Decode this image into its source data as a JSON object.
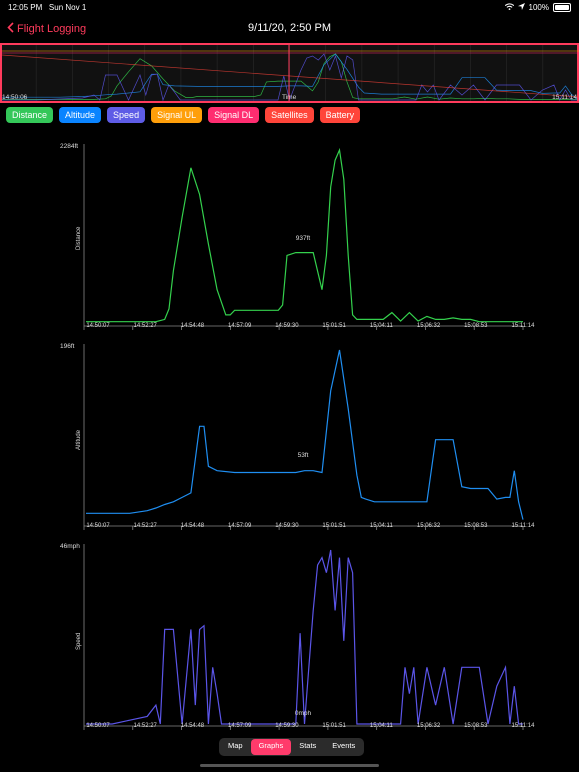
{
  "status": {
    "time": "12:05 PM",
    "date": "Sun Nov 1",
    "battery": "100%"
  },
  "nav": {
    "back_label": "Flight Logging",
    "title": "9/11/20, 2:50 PM"
  },
  "overview": {
    "start": "14:50:06",
    "axis_label": "Time",
    "end": "15:11:14"
  },
  "chips": [
    {
      "label": "Distance",
      "color": "#34c759"
    },
    {
      "label": "Altitude",
      "color": "#0a84ff"
    },
    {
      "label": "Speed",
      "color": "#5e5ce6"
    },
    {
      "label": "Signal UL",
      "color": "#ff9f0a"
    },
    {
      "label": "Signal DL",
      "color": "#ff2d70"
    },
    {
      "label": "Satellites",
      "color": "#ff453a"
    },
    {
      "label": "Battery",
      "color": "#ff453a"
    }
  ],
  "x_ticks": [
    "14:50:07",
    "14:52:27",
    "14:54:48",
    "14:57:09",
    "14:59:30",
    "15:01:51",
    "15:04:11",
    "15:06:32",
    "15:08:53",
    "15:11:14"
  ],
  "chart_data": [
    {
      "type": "line",
      "ylabel": "Distance",
      "ymax_label": "2284ft",
      "annotation": "937ft",
      "color": "#34d14d",
      "ylim": [
        0,
        2284
      ],
      "x": [
        0,
        4,
        8,
        12,
        16,
        18,
        19,
        20,
        22,
        24,
        26,
        28,
        30,
        32,
        33,
        34,
        36,
        38,
        40,
        41,
        42,
        43,
        44,
        45,
        46,
        48,
        50,
        52,
        54,
        55,
        56,
        57,
        58,
        59,
        60,
        61,
        62,
        64,
        66,
        68,
        70,
        72,
        74,
        76,
        78,
        80,
        82,
        84,
        86,
        88,
        90,
        92,
        94,
        96,
        100
      ],
      "y": [
        30,
        30,
        30,
        30,
        30,
        60,
        200,
        700,
        1400,
        2050,
        1700,
        1050,
        450,
        120,
        120,
        180,
        180,
        180,
        180,
        180,
        180,
        180,
        180,
        250,
        900,
        937,
        937,
        937,
        450,
        900,
        1800,
        2150,
        2284,
        1900,
        900,
        120,
        60,
        60,
        60,
        60,
        150,
        40,
        150,
        40,
        100,
        60,
        60,
        80,
        60,
        60,
        30,
        30,
        30,
        30,
        30
      ]
    },
    {
      "type": "line",
      "ylabel": "Altitude",
      "ymax_label": "196ft",
      "annotation": "53ft",
      "color": "#1f8ef1",
      "ylim": [
        0,
        196
      ],
      "x": [
        0,
        6,
        10,
        14,
        16,
        18,
        20,
        22,
        24,
        26,
        27,
        28,
        30,
        34,
        38,
        42,
        46,
        48,
        50,
        52,
        54,
        56,
        58,
        60,
        62,
        63,
        64,
        66,
        68,
        72,
        74,
        76,
        78,
        80,
        82,
        84,
        86,
        88,
        90,
        92,
        94,
        96,
        97,
        98,
        99,
        100
      ],
      "y": [
        12,
        12,
        12,
        15,
        18,
        22,
        25,
        30,
        35,
        110,
        110,
        65,
        60,
        58,
        58,
        58,
        58,
        58,
        60,
        60,
        58,
        150,
        196,
        130,
        55,
        30,
        28,
        25,
        25,
        25,
        25,
        25,
        25,
        95,
        95,
        95,
        42,
        40,
        40,
        40,
        28,
        30,
        30,
        60,
        25,
        5
      ]
    },
    {
      "type": "line",
      "ylabel": "Speed",
      "ymax_label": "46mph",
      "annotation": "0mph",
      "color": "#5b55e8",
      "ylim": [
        0,
        46
      ],
      "x": [
        0,
        6,
        10,
        14,
        16,
        17,
        18,
        19,
        20,
        22,
        24,
        25,
        26,
        27,
        28,
        29,
        30,
        31,
        32,
        33,
        34,
        36,
        38,
        40,
        42,
        44,
        46,
        47,
        48,
        49,
        50,
        52,
        53,
        54,
        55,
        56,
        57,
        58,
        59,
        60,
        61,
        62,
        63,
        64,
        66,
        68,
        70,
        72,
        73,
        74,
        75,
        76,
        78,
        80,
        82,
        84,
        86,
        88,
        90,
        92,
        94,
        96,
        97,
        98,
        99,
        100
      ],
      "y": [
        0,
        0,
        1,
        2,
        5,
        0,
        25,
        25,
        25,
        0,
        25,
        5,
        25,
        26,
        0,
        15,
        8,
        0,
        0,
        0,
        0,
        0,
        0,
        0,
        0,
        0,
        0,
        0,
        0,
        24,
        0,
        30,
        42,
        44,
        40,
        46,
        30,
        44,
        22,
        44,
        40,
        0,
        0,
        0,
        0,
        0,
        0,
        0,
        15,
        8,
        15,
        0,
        15,
        5,
        15,
        0,
        15,
        15,
        15,
        0,
        10,
        15,
        0,
        10,
        0,
        0
      ]
    }
  ],
  "tabs": [
    {
      "label": "Map",
      "active": false
    },
    {
      "label": "Graphs",
      "active": true
    },
    {
      "label": "Stats",
      "active": false
    },
    {
      "label": "Events",
      "active": false
    }
  ]
}
